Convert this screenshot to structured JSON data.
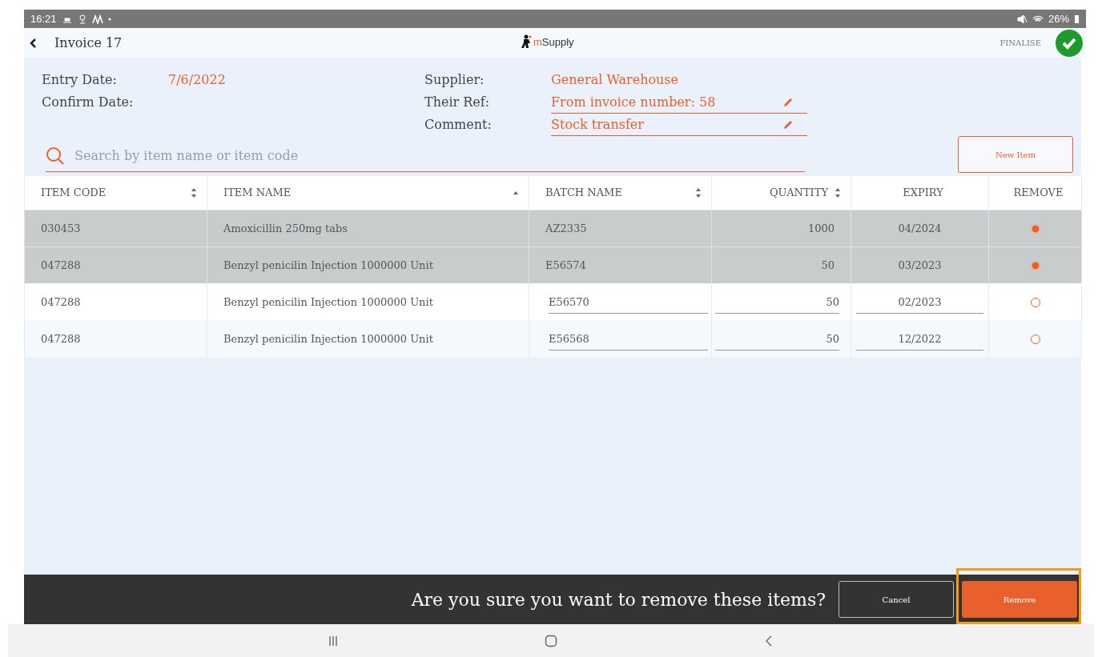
{
  "status_bar": {
    "time": "16:21",
    "battery": "26%"
  },
  "header": {
    "title": "Invoice 17",
    "logo_text": "mSupply",
    "action": "FINALISE"
  },
  "info": {
    "left": [
      {
        "label": "Entry Date:",
        "value": "7/6/2022",
        "kind": "text"
      },
      {
        "label": "Confirm Date:"
      }
    ],
    "right": [
      {
        "label": "Supplier:",
        "value": "General Warehouse",
        "kind": "text"
      },
      {
        "label": "Their Ref:",
        "value": "From invoice number: 58",
        "kind": "editable"
      },
      {
        "label": "Comment:",
        "value": "Stock transfer",
        "kind": "editable"
      }
    ]
  },
  "search": {
    "placeholder": "Search by item name or item code"
  },
  "new_item_button": "New Item",
  "table": {
    "columns": [
      {
        "label": "ITEM CODE",
        "sortable": true,
        "sorted": false
      },
      {
        "label": "ITEM NAME",
        "sortable": true,
        "sorted": true
      },
      {
        "label": "BATCH NAME",
        "sortable": true,
        "sorted": false
      },
      {
        "label": "QUANTITY",
        "sortable": true,
        "sorted": false
      },
      {
        "label": "EXPIRY",
        "sortable": false
      },
      {
        "label": "REMOVE",
        "sortable": false
      }
    ],
    "rows": [
      {
        "cells": [
          "030453",
          "Amoxicillin 250mg tabs",
          "AZ2335",
          "1000",
          "04/2024"
        ],
        "selected": true
      },
      {
        "cells": [
          "047288",
          "Benzyl penicilin Injection 1000000 Unit",
          "E56574",
          "50",
          "03/2023"
        ],
        "selected": true
      },
      {
        "cells": [
          "047288",
          "Benzyl penicilin Injection 1000000 Unit",
          "E56570",
          "50",
          "02/2023"
        ],
        "selected": false
      },
      {
        "cells": [
          "047288",
          "Benzyl penicilin Injection 1000000 Unit",
          "E56568",
          "50",
          "12/2022"
        ],
        "selected": false
      }
    ]
  },
  "confirm": {
    "message": "Are you sure you want to remove these items?",
    "buttons": [
      {
        "label": "Cancel",
        "kind": "secondary"
      },
      {
        "label": "Remove",
        "kind": "primary",
        "highlighted": true
      }
    ]
  }
}
